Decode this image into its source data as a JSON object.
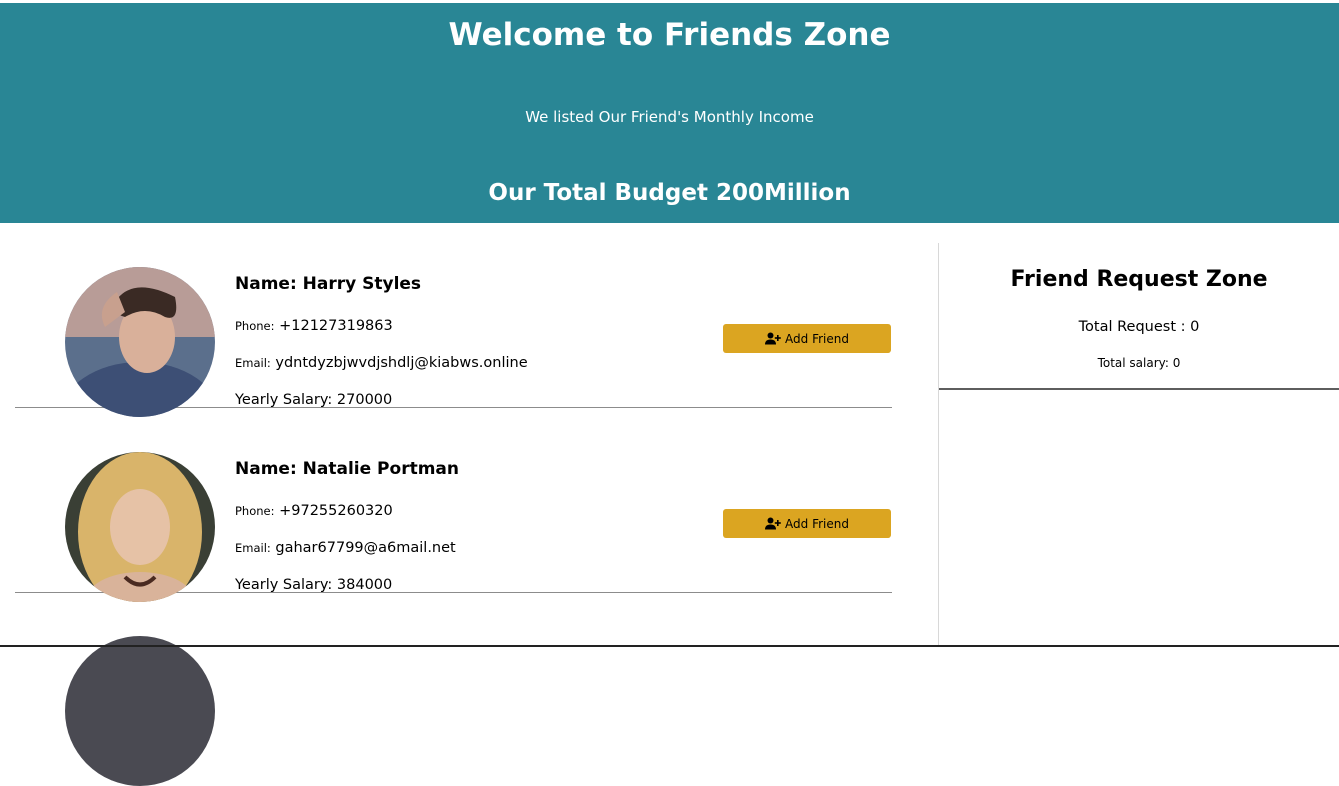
{
  "header": {
    "title": "Welcome to Friends Zone",
    "subtitle": "We listed Our Friend's Monthly Income",
    "budget": "Our Total Budget 200Million"
  },
  "friends": [
    {
      "name": "Name: Harry Styles",
      "phone_label": "Phone:",
      "phone": "+12127319863",
      "email_label": "Email:",
      "email": "ydntdyzbjwvdjshdlj@kiabws.online",
      "salary": "Yearly Salary: 270000",
      "button_label": "Add Friend"
    },
    {
      "name": "Name: Natalie Portman",
      "phone_label": "Phone:",
      "phone": "+97255260320",
      "email_label": "Email:",
      "email": "gahar67799@a6mail.net",
      "salary": "Yearly Salary: 384000",
      "button_label": "Add Friend"
    }
  ],
  "request_zone": {
    "title": "Friend Request Zone",
    "total_request": "Total Request : 0",
    "total_salary": "Total salary: 0"
  },
  "colors": {
    "header_bg": "#298695",
    "button_bg": "#dba521"
  },
  "icons": {
    "add_friend": "user-plus-icon"
  }
}
